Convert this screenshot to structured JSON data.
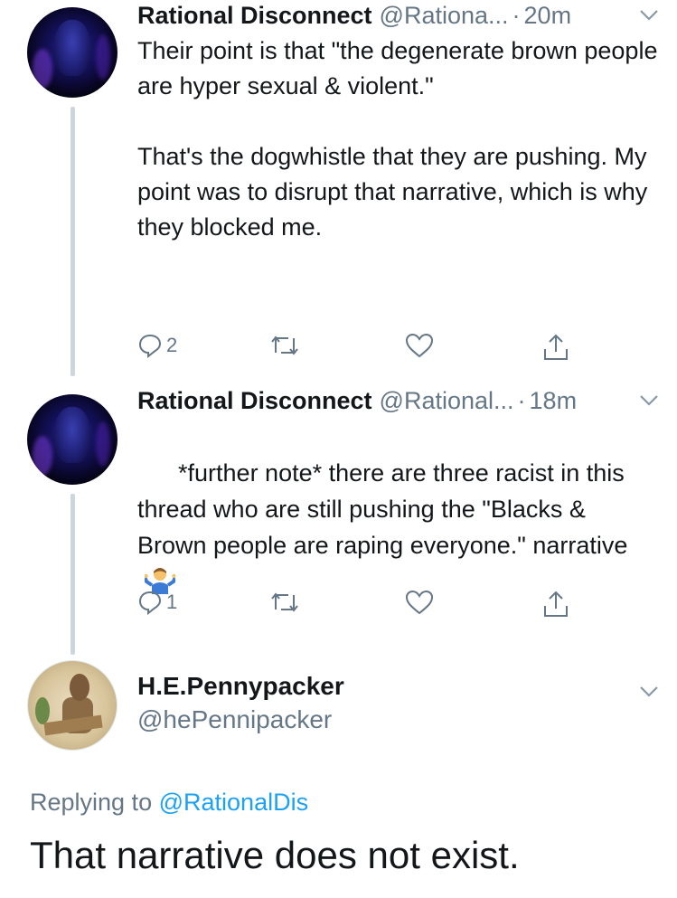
{
  "tweets": [
    {
      "name": "Rational Disconnect",
      "handle": "@Rationa...",
      "time": "20m",
      "text": "Their point is that \"the degenerate brown people are hyper sexual & violent.\"\n\nThat's the dogwhistle that they are pushing. My point was to disrupt that narrative, which is why they blocked me.",
      "reply_count": "2"
    },
    {
      "name": "Rational Disconnect",
      "handle": "@Rational...",
      "time": "18m",
      "text": "*further note* there are three racist in this thread who are still pushing the \"Blacks & Brown people are raping everyone.\" narrative",
      "emoji": "man-shrugging-emoji",
      "reply_count": "1"
    }
  ],
  "main_tweet": {
    "name": "H.E.Pennypacker",
    "handle": "@hePennipacker",
    "replying_prefix": "Replying to",
    "replying_to": "@RationalDis",
    "text": "That narrative does not exist."
  },
  "colors": {
    "primary_text": "#14171a",
    "secondary_text": "#657786",
    "link": "#1da1f2",
    "thread_line": "#ccd6dd"
  }
}
